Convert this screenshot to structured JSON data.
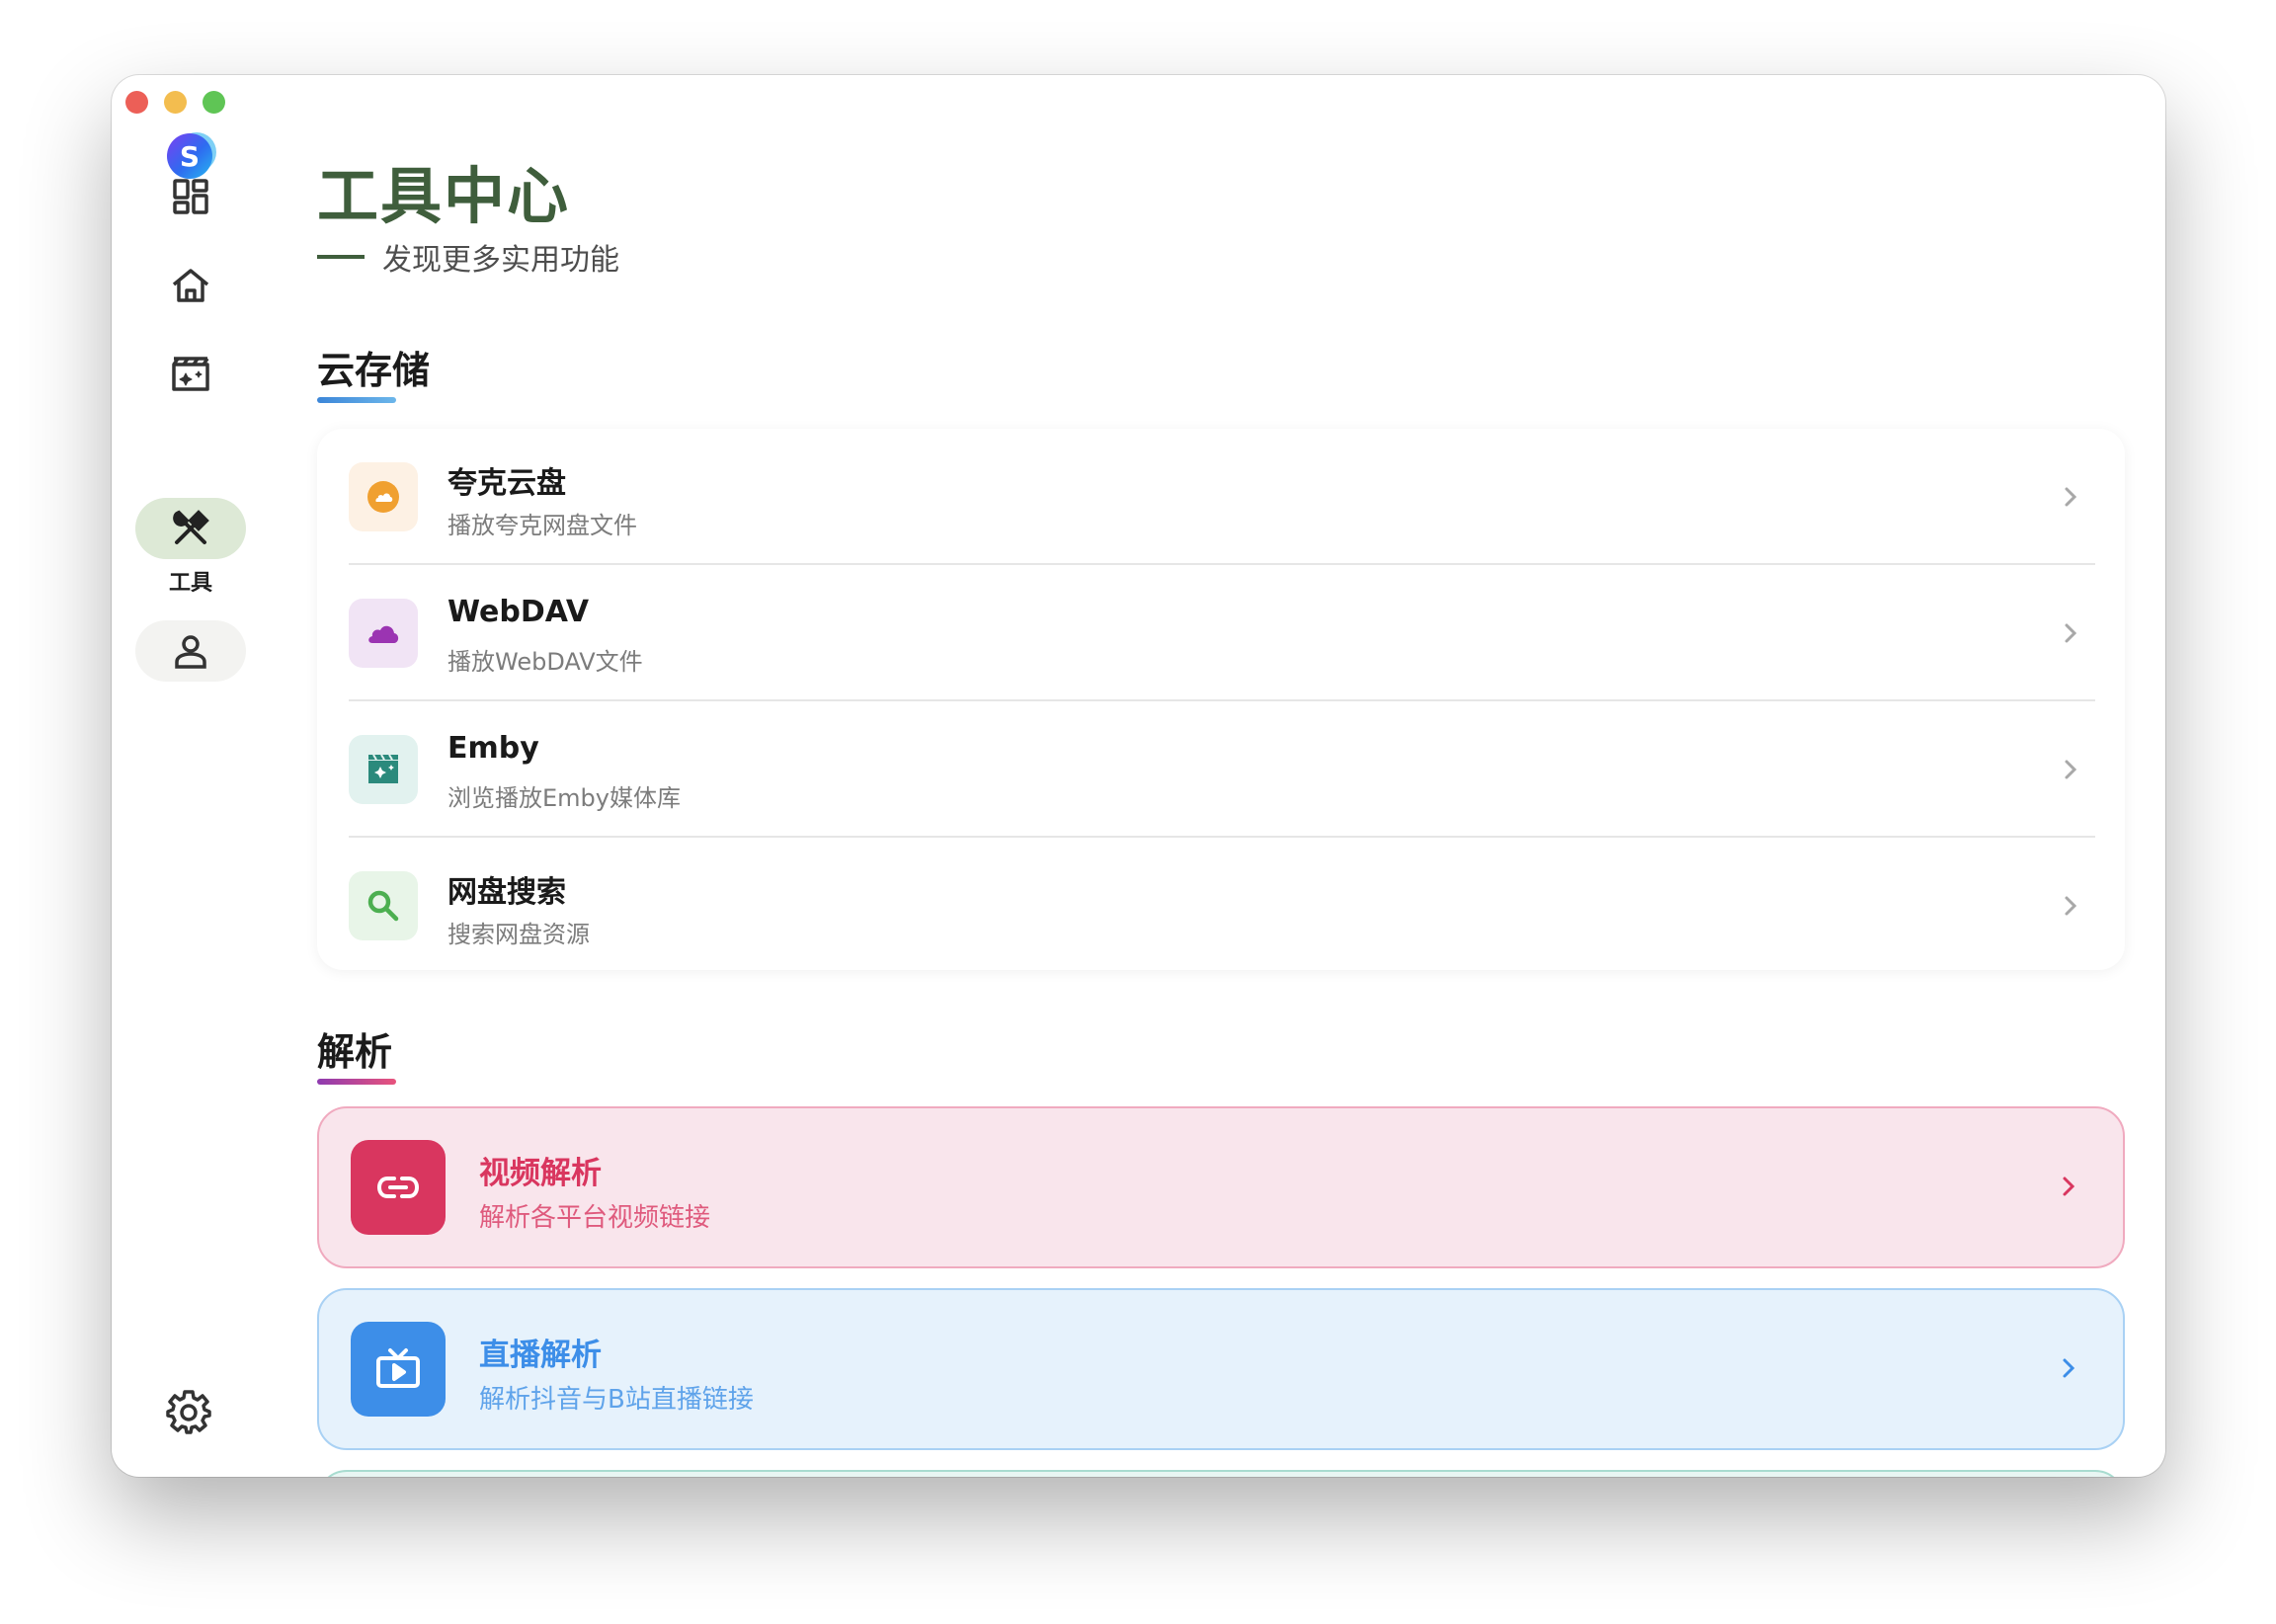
{
  "sidebar": {
    "logo_letter": "S",
    "items": [
      {
        "name": "dashboard",
        "icon": "dashboard-icon"
      },
      {
        "name": "home",
        "icon": "home-icon"
      },
      {
        "name": "media",
        "icon": "movie-icon"
      },
      {
        "name": "tools",
        "icon": "tools-icon",
        "label": "工具",
        "active": true
      },
      {
        "name": "profile",
        "icon": "person-icon"
      }
    ],
    "settings_icon": "gear-icon"
  },
  "page": {
    "title": "工具中心",
    "subtitle": "发现更多实用功能"
  },
  "sections": {
    "cloud": {
      "title": "云存储",
      "accent": "#4a9fdf",
      "items": [
        {
          "title": "夸克云盘",
          "subtitle": "播放夸克网盘文件",
          "icon": "cloud-icon",
          "icon_color": "#f0a030",
          "icon_bg": "#fdf1e4"
        },
        {
          "title": "WebDAV",
          "subtitle": "播放WebDAV文件",
          "icon": "cloud-icon",
          "icon_color": "#9b34b2",
          "icon_bg": "#f1e4f5"
        },
        {
          "title": "Emby",
          "subtitle": "浏览播放Emby媒体库",
          "icon": "movie-icon",
          "icon_color": "#2b8a7c",
          "icon_bg": "#e2f2ef"
        },
        {
          "title": "网盘搜索",
          "subtitle": "搜索网盘资源",
          "icon": "search-icon",
          "icon_color": "#4caf50",
          "icon_bg": "#e8f5e8"
        }
      ]
    },
    "parse": {
      "title": "解析",
      "accent_from": "#8e3bb0",
      "accent_to": "#e8537c",
      "items": [
        {
          "title": "视频解析",
          "subtitle": "解析各平台视频链接",
          "icon": "link-icon",
          "title_color": "#d9365f",
          "sub_color": "#df5a7d",
          "icon_bg": "#d9365f"
        },
        {
          "title": "直播解析",
          "subtitle": "解析抖音与B站直播链接",
          "icon": "tv-icon",
          "title_color": "#3d8ee8",
          "sub_color": "#5fa3ea",
          "icon_bg": "#3d8ee8"
        }
      ]
    }
  }
}
